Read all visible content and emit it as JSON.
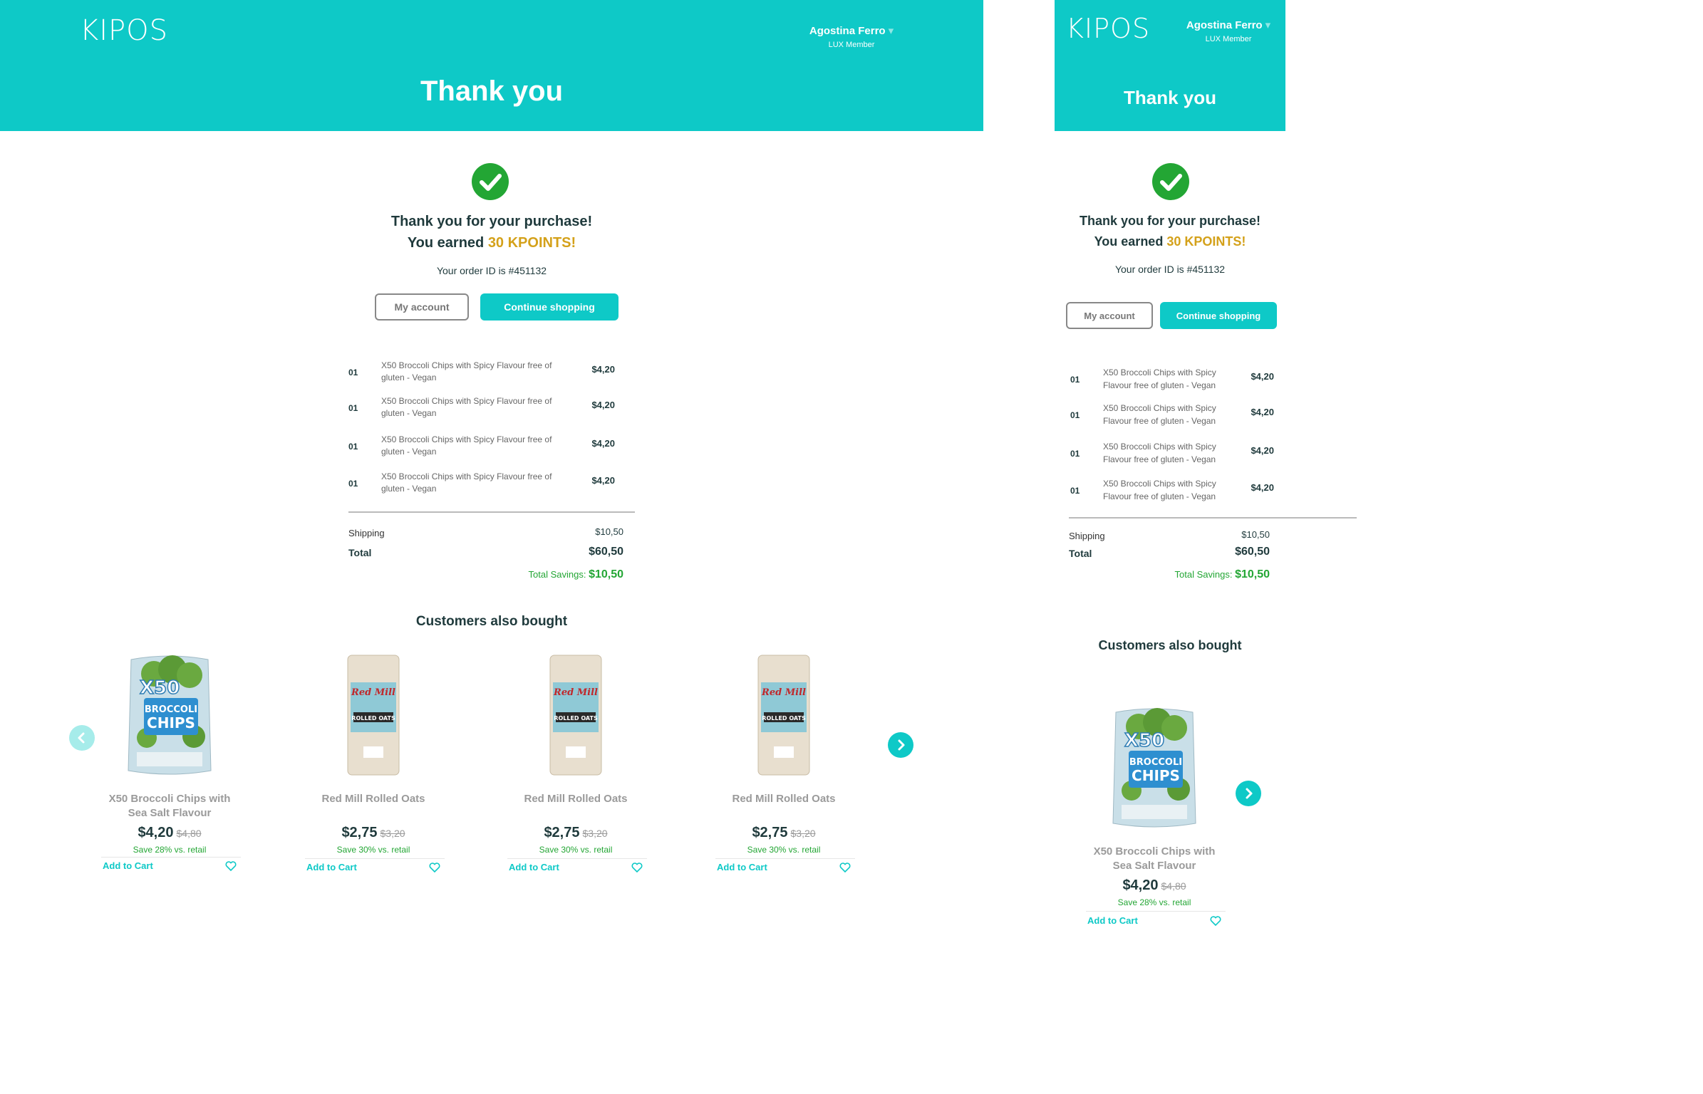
{
  "brand": {
    "logo": "KIPOS"
  },
  "user": {
    "name": "Agostina Ferro",
    "caret": "▾",
    "tier": "LUX Member"
  },
  "page": {
    "title": "Thank you"
  },
  "confirmation": {
    "line1": "Thank you for your purchase!",
    "earned_prefix": "You earned ",
    "earned_points": "30 KPOINTS!",
    "order_id": "Your order ID is #451132",
    "my_account": "My account",
    "continue": "Continue shopping"
  },
  "desktop_items": [
    {
      "qty": "01",
      "desc": "X50 Broccoli Chips with Spicy Flavour free of gluten - Vegan",
      "price": "$4,20"
    },
    {
      "qty": "01",
      "desc": "X50 Broccoli Chips with Spicy Flavour free of gluten - Vegan",
      "price": "$4,20"
    },
    {
      "qty": "01",
      "desc": "X50 Broccoli Chips with Spicy Flavour free of gluten - Vegan",
      "price": "$4,20"
    },
    {
      "qty": "01",
      "desc": "X50 Broccoli Chips with Spicy Flavour free of gluten - Vegan",
      "price": "$4,20"
    }
  ],
  "mobile_items": [
    {
      "qty": "01",
      "desc": "X50 Broccoli Chips with Spicy Flavour free of gluten - Vegan",
      "price": "$4,20"
    },
    {
      "qty": "01",
      "desc": "X50 Broccoli Chips with Spicy Flavour free of gluten - Vegan",
      "price": "$4,20"
    },
    {
      "qty": "01",
      "desc": "X50 Broccoli Chips with Spicy Flavour free of gluten - Vegan",
      "price": "$4,20"
    },
    {
      "qty": "01",
      "desc": "X50 Broccoli Chips with Spicy Flavour free of gluten - Vegan",
      "price": "$4,20"
    }
  ],
  "totals": {
    "shipping_label": "Shipping",
    "shipping": "$10,50",
    "total_label": "Total",
    "total": "$60,50",
    "savings_label": "Total Savings: ",
    "savings": "$10,50"
  },
  "recommend": {
    "title": "Customers also bought",
    "add_to_cart": "Add to Cart",
    "products": [
      {
        "name": "X50 Broccoli Chips with Sea Salt Flavour",
        "price": "$4,20",
        "old": "$4,80",
        "save": "Save 28% vs. retail",
        "image": "broccoli-chips-bag"
      },
      {
        "name": "Red Mill Rolled Oats",
        "price": "$2,75",
        "old": "$3,20",
        "save": "Save 30% vs. retail",
        "image": "rolled-oats-bag"
      },
      {
        "name": "Red Mill Rolled Oats",
        "price": "$2,75",
        "old": "$3,20",
        "save": "Save 30% vs. retail",
        "image": "rolled-oats-bag"
      },
      {
        "name": "Red Mill Rolled Oats",
        "price": "$2,75",
        "old": "$3,20",
        "save": "Save 30% vs. retail",
        "image": "rolled-oats-bag"
      }
    ]
  },
  "colors": {
    "brand": "#0ec9c7",
    "success": "#23a634",
    "points": "#d4a11a",
    "text": "#1f3a3c"
  }
}
